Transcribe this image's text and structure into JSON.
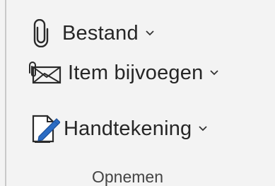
{
  "ribbon_group": {
    "label": "Opnemen",
    "commands": [
      {
        "label": "Bestand",
        "icon": "paperclip-icon"
      },
      {
        "label": "Item bijvoegen",
        "icon": "attach-item-icon"
      },
      {
        "label": "Handtekening",
        "icon": "signature-icon"
      }
    ]
  },
  "colors": {
    "background": "#f3f3f3",
    "text": "#262626",
    "icon_accent": "#2b6cc4"
  }
}
